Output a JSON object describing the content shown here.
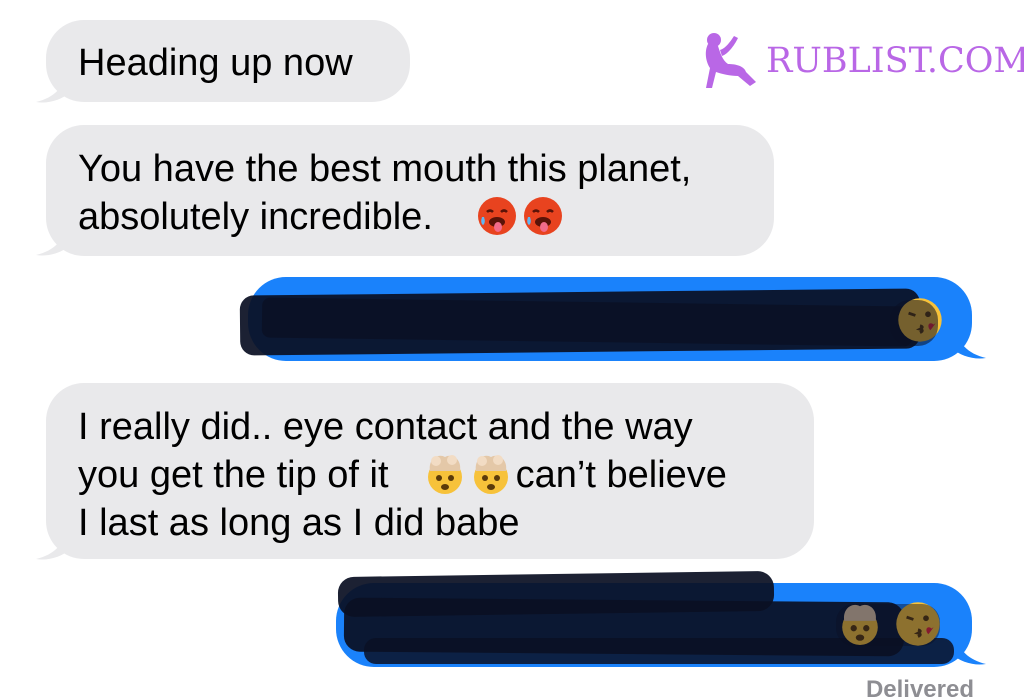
{
  "watermark": {
    "text": "RUBLIST.COM",
    "logo_icon": "dancer-silhouette-icon",
    "color": "#b967e6"
  },
  "messages": [
    {
      "direction": "incoming",
      "text": "Heading up now"
    },
    {
      "direction": "incoming",
      "text": "You have the best mouth this planet,\nabsolutely incredible.",
      "emojis": [
        "hot-face-emoji",
        "hot-face-emoji"
      ]
    },
    {
      "direction": "outgoing",
      "redacted": true,
      "emojis": [
        "kissing-face-emoji"
      ]
    },
    {
      "direction": "incoming",
      "line1": "I really did.. eye contact and the way",
      "line2_start": "you get the tip of it",
      "line2_end": "can’t believe",
      "line3": "I last as long as I did babe",
      "emojis": [
        "exploding-head-emoji",
        "exploding-head-emoji"
      ]
    },
    {
      "direction": "outgoing",
      "redacted": true,
      "emojis": [
        "exploding-head-emoji",
        "kissing-face-emoji"
      ]
    }
  ],
  "status": "Delivered",
  "colors": {
    "incoming_bubble": "#e9e9eb",
    "outgoing_bubble": "#1a82fb",
    "redaction": "#0b1024",
    "status_text": "#8e8e93"
  }
}
